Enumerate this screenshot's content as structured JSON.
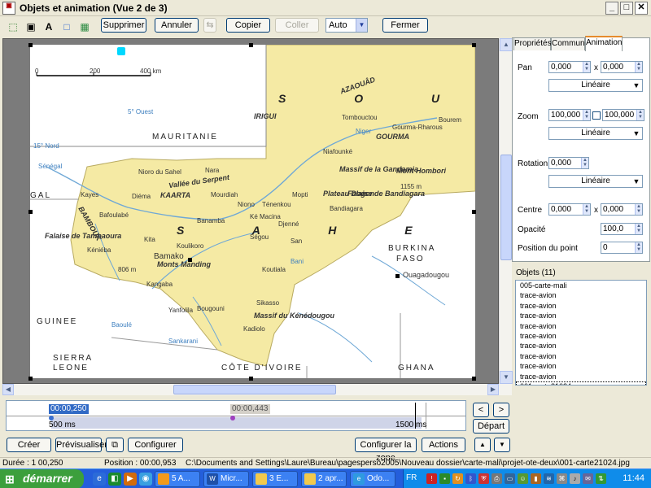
{
  "window": {
    "title": "Objets et animation  (Vue 2 de 3)",
    "minimize": "_",
    "maximize": "□",
    "close": "✕"
  },
  "toolbar": {
    "icons": [
      "select-icon",
      "image-icon",
      "text-icon",
      "rectangle-icon",
      "picture-icon"
    ],
    "delete_label": "Supprimer",
    "undo_label": "Annuler",
    "redo_label": "⇆",
    "copy_label": "Copier",
    "paste_label": "Coller",
    "zoom_value": "Auto",
    "close_label": "Fermer"
  },
  "map": {
    "scale": {
      "s0": "0",
      "s200": "200",
      "s400": "400 km"
    },
    "countries": {
      "mauritanie": "MAURITANIE",
      "burkina": "BURKINA",
      "faso": "FASO",
      "guinee": "GUINEE",
      "sierra": "SIERRA",
      "leone": "LEONE",
      "cote": "CÔTE D'IVOIRE",
      "ghana": "GHANA",
      "gal": "GAL"
    },
    "regions": {
      "soud": "S O U D",
      "sahel": "S A H E L",
      "kaarta": "KAARTA",
      "bambouk": "BAMBOUK",
      "gourma": "GOURMA",
      "azaouad": "AZAOUÂD",
      "irigui": "IRIGUI",
      "vallee": "Vallée du Serpent"
    },
    "cities": [
      {
        "name": "Tombouctou"
      },
      {
        "name": "Gourma-Rharous"
      },
      {
        "name": "Bourem"
      },
      {
        "name": "Niafounké"
      },
      {
        "name": "Nioro du Sahel"
      },
      {
        "name": "Nara"
      },
      {
        "name": "Kayes"
      },
      {
        "name": "Diéma"
      },
      {
        "name": "Mourdiah"
      },
      {
        "name": "Niono"
      },
      {
        "name": "Ténenkou"
      },
      {
        "name": "Mopti"
      },
      {
        "name": "Bandiagara"
      },
      {
        "name": "Ké Macina"
      },
      {
        "name": "Djenné"
      },
      {
        "name": "Ségou"
      },
      {
        "name": "San"
      },
      {
        "name": "Bamako"
      },
      {
        "name": "Koutiala"
      },
      {
        "name": "Sikasso"
      },
      {
        "name": "Kadiolo"
      },
      {
        "name": "Bougouni"
      },
      {
        "name": "Yanfolila"
      },
      {
        "name": "Kangaba"
      },
      {
        "name": "Kita"
      },
      {
        "name": "Koulikoro"
      },
      {
        "name": "Banamba"
      },
      {
        "name": "Bafoulabé"
      },
      {
        "name": "Kéniéba"
      },
      {
        "name": "Ouagadougou"
      },
      {
        "name": "Douentza"
      },
      {
        "name": "Hombori"
      },
      {
        "name": "Fana"
      },
      {
        "name": "Dioïla"
      },
      {
        "name": "Kolondiéba"
      },
      {
        "name": "Goundam"
      }
    ],
    "features": {
      "mont_hombori": "Mont Hombori",
      "hombori_alt": "1155 m",
      "massif": "Massif de la Gandamia",
      "falaise": "Falaise de Bandiagara",
      "plateau": "Plateau Dogon",
      "monts": "Monts Manding",
      "falaise_tam": "Falaise de Tambaoura",
      "massif_ken": "Massif du Kénédougou",
      "alt_806": "806 m",
      "niger": "Niger",
      "baoule": "Baoulé",
      "bani": "Bani",
      "sankarani": "Sankarani",
      "senegal": "Sénégal",
      "grid_1": "5° Ouest",
      "grid_2": "15° Nord"
    }
  },
  "timeline": {
    "current_time": "00:00,250",
    "second_time": "00:00,443",
    "start_label": "500 ms",
    "end_label": "1500 ms",
    "prev_label": "<",
    "next_label": ">",
    "depart_label": "Départ"
  },
  "panel": {
    "tabs": [
      "Propriétés",
      "Commun",
      "Animation"
    ],
    "active_tab": "Animation",
    "pan_label": "Pan",
    "pan_x": "0,000",
    "pan_y": "0,000",
    "x_label": "x",
    "pan_interp": "Linéaire",
    "zoom_label": "Zoom",
    "zoom_x": "100,000",
    "zoom_y": "100,000",
    "zoom_interp": "Linéaire",
    "rotation_label": "Rotation",
    "rotation_value": "0,000",
    "rotation_interp": "Linéaire",
    "centre_label": "Centre",
    "centre_x": "0,000",
    "centre_y": "0,000",
    "opacity_label": "Opacité",
    "opacity_value": "100,0",
    "position_label": "Position du point",
    "position_value": "0"
  },
  "objects": {
    "title": "Objets (11)",
    "items": [
      "005-carte-mali",
      "trace-avion",
      "trace-avion",
      "trace-avion",
      "trace-avion",
      "trace-avion",
      "trace-avion",
      "trace-avion",
      "trace-avion",
      "trace-avion",
      "001-carte21024"
    ],
    "selected_index": 10
  },
  "bottom": {
    "create_label": "Créer",
    "preview_label": "Prévisualiser",
    "configure_label": "Configurer",
    "configure_zone_label": "Configurer la zone",
    "actions_label": "Actions",
    "up_label": "▲",
    "down_label": "▼"
  },
  "status": {
    "duration": "Durée : 1 00,250",
    "position": "Position : 00:00,953",
    "path": "C:\\Documents and Settings\\Laure\\Bureau\\pagesperso2005\\Nouveau dossier\\carte-mali\\projet-ote-deux\\001-carte21024.jpg"
  },
  "taskbar": {
    "start_label": "démarrer",
    "tasks": [
      "5 A...",
      "Micr...",
      "3 E...",
      "2 apr...",
      "Odo...",
      "FR"
    ],
    "clock": "11:44"
  },
  "colors": {
    "map_land": "#f5eaa4",
    "map_border": "#8a8a8a",
    "accent": "#316ac5",
    "taskbar": "#245edb",
    "start": "#3c9f3c"
  }
}
